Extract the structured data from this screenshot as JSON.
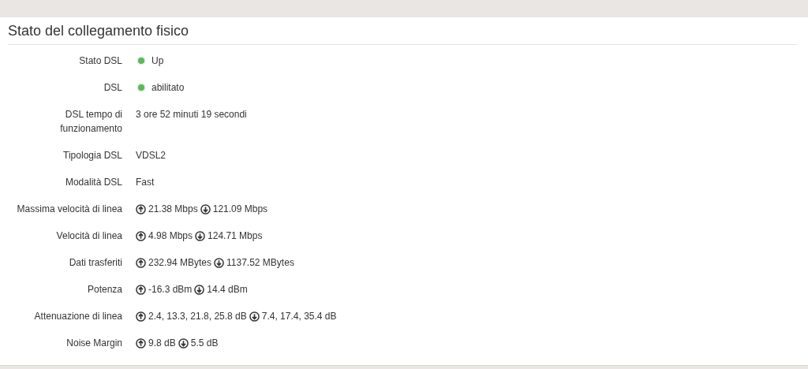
{
  "section": {
    "title": "Stato del collegamento fisico"
  },
  "rows": [
    {
      "label": "Stato DSL",
      "kind": "status",
      "color": "#5cb85c",
      "value": "Up"
    },
    {
      "label": "DSL",
      "kind": "status",
      "color": "#5cb85c",
      "value": "abilitato"
    },
    {
      "label": "DSL tempo di funzionamento",
      "kind": "text",
      "value": "3 ore 52 minuti 19 secondi"
    },
    {
      "label": "Tipologia DSL",
      "kind": "text",
      "value": "VDSL2"
    },
    {
      "label": "Modalità DSL",
      "kind": "text",
      "value": "Fast"
    },
    {
      "label": "Massima velocità di linea",
      "kind": "updown",
      "up": "21.38 Mbps",
      "down": "121.09 Mbps"
    },
    {
      "label": "Velocità di linea",
      "kind": "updown",
      "up": "4.98 Mbps",
      "down": "124.71 Mbps"
    },
    {
      "label": "Dati trasferiti",
      "kind": "updown",
      "up": "232.94 MBytes",
      "down": "1137.52 MBytes"
    },
    {
      "label": "Potenza",
      "kind": "updown",
      "up": "-16.3 dBm",
      "down": "14.4 dBm"
    },
    {
      "label": "Attenuazione di linea",
      "kind": "updown",
      "up": "2.4, 13.3, 21.8, 25.8 dB",
      "down": "7.4, 17.4, 35.4 dB"
    },
    {
      "label": "Noise Margin",
      "kind": "updown",
      "up": "9.8 dB",
      "down": "5.5 dB"
    }
  ]
}
